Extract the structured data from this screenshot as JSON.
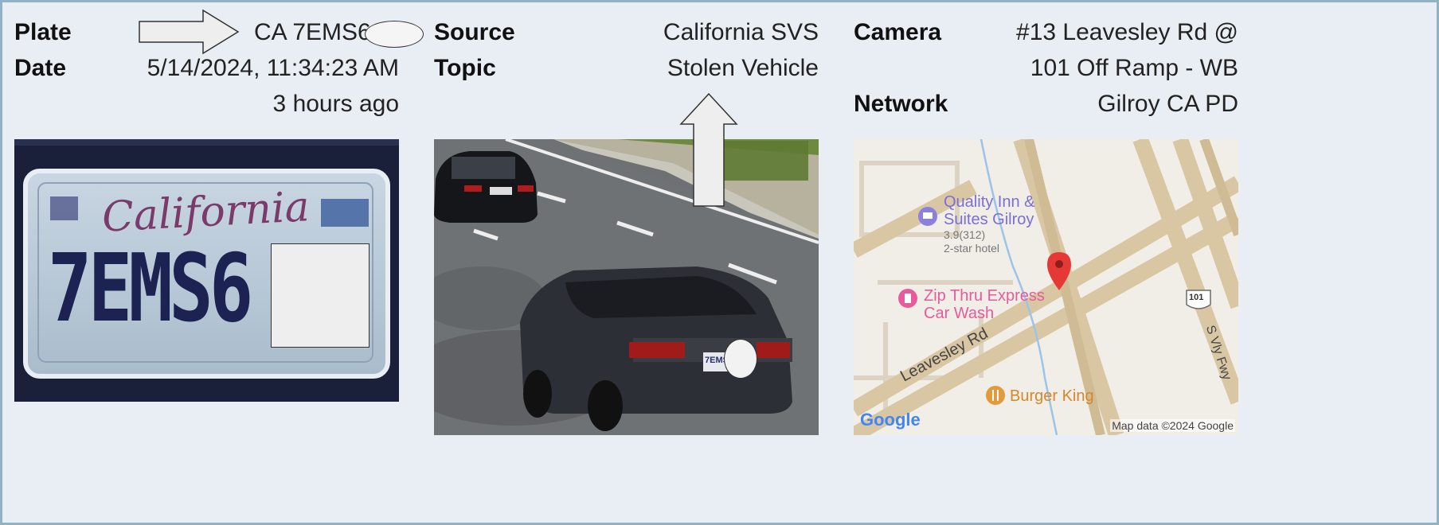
{
  "details": {
    "plate_label": "Plate",
    "plate_value": "CA 7EMS6",
    "date_label": "Date",
    "date_value": "5/14/2024, 11:34:23 AM",
    "relative_time": "3 hours ago",
    "source_label": "Source",
    "source_value": "California SVS",
    "topic_label": "Topic",
    "topic_value": "Stolen Vehicle",
    "camera_label": "Camera",
    "camera_value_line1": "#13 Leavesley Rd @",
    "camera_value_line2": "101 Off Ramp - WB",
    "network_label": "Network",
    "network_value": "Gilroy CA PD"
  },
  "plate_image": {
    "state_script": "California",
    "plate_text": "7EMS6"
  },
  "vehicle_image": {
    "small_plate_text": "7EMS"
  },
  "map": {
    "hotel_name_line1": "Quality Inn &",
    "hotel_name_line2": "Suites Gilroy",
    "hotel_rating": "3.9(312)",
    "hotel_class": "2-star hotel",
    "carwash_line1": "Zip Thru Express",
    "carwash_line2": "Car Wash",
    "road_name": "Leavesley Rd",
    "restaurant": "Burger King",
    "highway_shield": "101",
    "freeway_name": "S Vly Fwy",
    "logo": "Google",
    "attribution": "Map data ©2024 Google"
  },
  "colors": {
    "accent_pin": "#e53935",
    "hotel_text": "#7b6fd6",
    "carwash_text": "#e85b9a",
    "restaurant_text": "#d8862a"
  }
}
